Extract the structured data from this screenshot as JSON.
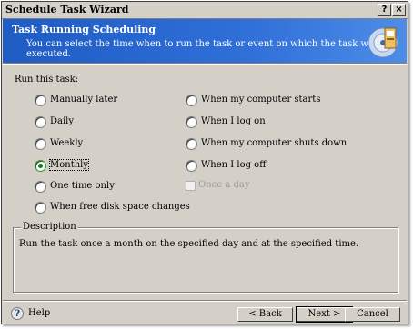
{
  "window": {
    "title": "Schedule Task Wizard",
    "controls": {
      "help": "?",
      "close": "×"
    }
  },
  "header": {
    "title": "Task Running Scheduling",
    "subtitle": "You can select the time when to run the task or event on which the task will be executed."
  },
  "run_label": "Run this task:",
  "options_left": [
    {
      "label": "Manually later",
      "checked": false
    },
    {
      "label": "Daily",
      "checked": false
    },
    {
      "label": "Weekly",
      "checked": false
    },
    {
      "label": "Monthly",
      "checked": true
    },
    {
      "label": "One time only",
      "checked": false
    },
    {
      "label": "When free disk space changes",
      "checked": false
    }
  ],
  "options_right": [
    {
      "label": "When my computer starts",
      "checked": false
    },
    {
      "label": "When I log on",
      "checked": false
    },
    {
      "label": "When my computer shuts down",
      "checked": false
    },
    {
      "label": "When I log off",
      "checked": false
    }
  ],
  "once_a_day": {
    "label": "Once a day",
    "enabled": false,
    "checked": false
  },
  "description": {
    "title": "Description",
    "text": "Run the task once a month on the specified day and at the specified time."
  },
  "footer": {
    "help_label": "Help",
    "back_label": "< Back",
    "next_label": "Next >",
    "cancel_label": "Cancel"
  },
  "colors": {
    "header_bg": "#2f6fd8",
    "dialog_bg": "#d4d0c8",
    "selected_radio": "#0a7d1a"
  }
}
